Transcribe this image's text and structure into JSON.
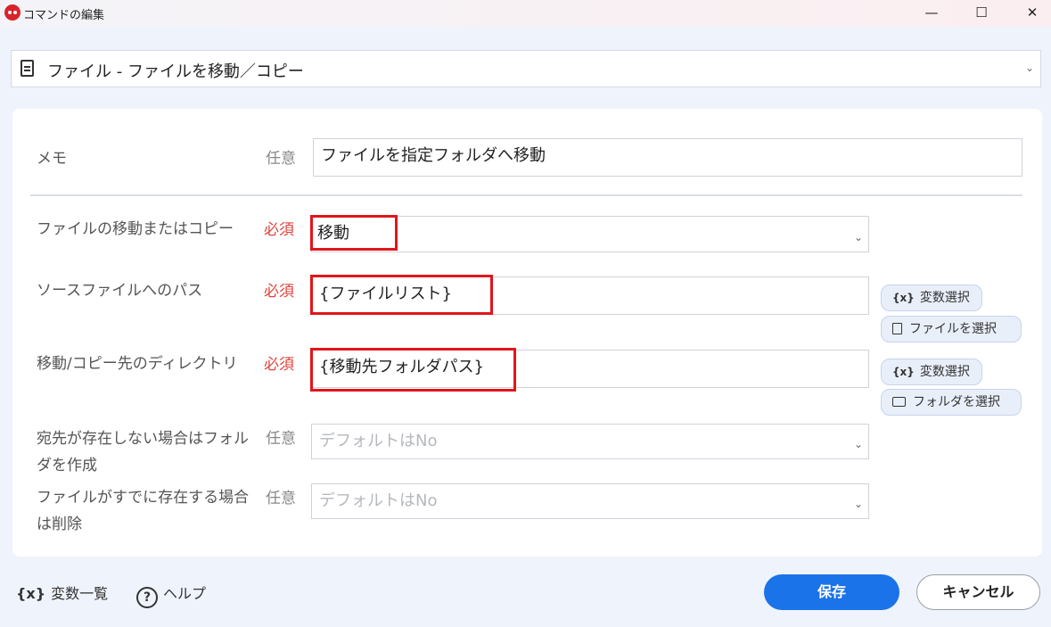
{
  "window": {
    "title": "コマンドの編集",
    "minimize": "—",
    "maximize": "☐",
    "close": "✕"
  },
  "command": {
    "selected": "ファイル - ファイルを移動／コピー"
  },
  "form": {
    "memo": {
      "label": "メモ",
      "req": "任意",
      "value": "ファイルを指定フォルダへ移動"
    },
    "op": {
      "label": "ファイルの移動またはコピー",
      "req": "必須",
      "value": "移動"
    },
    "source": {
      "label": "ソースファイルへのパス",
      "req": "必須",
      "value": "{ファイルリスト}",
      "var_btn": "変数選択",
      "file_btn": "ファイルを選択"
    },
    "dest": {
      "label": "移動/コピー先のディレクトリ",
      "req": "必須",
      "value": "{移動先フォルダパス}",
      "var_btn": "変数選択",
      "folder_btn": "フォルダを選択"
    },
    "create": {
      "label": "宛先が存在しない場合はフォルダを作成",
      "req": "任意",
      "placeholder": "デフォルトはNo"
    },
    "overwrite": {
      "label": "ファイルがすでに存在する場合は削除",
      "req": "任意",
      "placeholder": "デフォルトはNo"
    }
  },
  "footer": {
    "var_list": "変数一覧",
    "var_icon": "{x}",
    "help": "ヘルプ",
    "save": "保存",
    "cancel": "キャンセル"
  },
  "colors": {
    "accent": "#1a73e8",
    "required": "#e0443c",
    "highlight": "#e0161c"
  }
}
